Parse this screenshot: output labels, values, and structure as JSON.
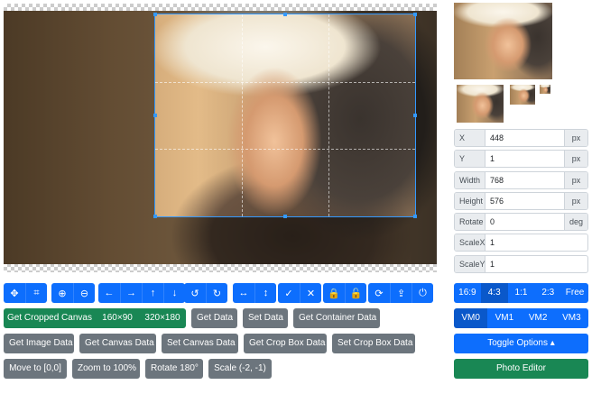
{
  "stage": {
    "grid_lines": true
  },
  "toolbar_icons": [
    {
      "group": "mode",
      "icons": [
        {
          "name": "move-icon",
          "glyph": "✥"
        },
        {
          "name": "crop-icon",
          "glyph": "⌗"
        }
      ]
    },
    {
      "group": "zoom",
      "icons": [
        {
          "name": "zoom-in-icon",
          "glyph": "⊕"
        },
        {
          "name": "zoom-out-icon",
          "glyph": "⊖"
        }
      ]
    },
    {
      "group": "move",
      "icons": [
        {
          "name": "arrow-left-icon",
          "glyph": "←"
        },
        {
          "name": "arrow-right-icon",
          "glyph": "→"
        },
        {
          "name": "arrow-up-icon",
          "glyph": "↑"
        },
        {
          "name": "arrow-down-icon",
          "glyph": "↓"
        }
      ]
    },
    {
      "group": "rotate",
      "icons": [
        {
          "name": "rotate-left-icon",
          "glyph": "↺"
        },
        {
          "name": "rotate-right-icon",
          "glyph": "↻"
        }
      ]
    },
    {
      "group": "flip",
      "icons": [
        {
          "name": "flip-horizontal-icon",
          "glyph": "↔"
        },
        {
          "name": "flip-vertical-icon",
          "glyph": "↕"
        }
      ]
    },
    {
      "group": "crop-action",
      "icons": [
        {
          "name": "check-icon",
          "glyph": "✓"
        },
        {
          "name": "close-icon",
          "glyph": "✕"
        }
      ]
    },
    {
      "group": "lock",
      "icons": [
        {
          "name": "lock-icon",
          "glyph": "🔒"
        },
        {
          "name": "unlock-icon",
          "glyph": "🔓"
        }
      ]
    },
    {
      "group": "misc",
      "icons": [
        {
          "name": "reset-icon",
          "glyph": "⟳"
        },
        {
          "name": "upload-icon",
          "glyph": "⇪"
        },
        {
          "name": "power-icon",
          "glyph": "⏻"
        }
      ]
    }
  ],
  "buttons": {
    "get_cropped_canvas": "Get Cropped Canvas",
    "size_160": "160×90",
    "size_320": "320×180",
    "get_data": "Get Data",
    "set_data": "Set Data",
    "get_container_data": "Get Container Data",
    "get_image_data": "Get Image Data",
    "get_canvas_data": "Get Canvas Data",
    "set_canvas_data": "Set Canvas Data",
    "get_crop_box_data": "Get Crop Box Data",
    "set_crop_box_data": "Set Crop Box Data",
    "move_to": "Move to [0,0]",
    "zoom_to": "Zoom to 100%",
    "rotate_180": "Rotate 180°",
    "scale": "Scale (-2, -1)"
  },
  "data_fields": [
    {
      "label": "X",
      "value": "448",
      "unit": "px"
    },
    {
      "label": "Y",
      "value": "1",
      "unit": "px"
    },
    {
      "label": "Width",
      "value": "768",
      "unit": "px"
    },
    {
      "label": "Height",
      "value": "576",
      "unit": "px"
    },
    {
      "label": "Rotate",
      "value": "0",
      "unit": "deg"
    },
    {
      "label": "ScaleX",
      "value": "1",
      "unit": ""
    },
    {
      "label": "ScaleY",
      "value": "1",
      "unit": ""
    }
  ],
  "aspect_ratios": {
    "options": [
      "16:9",
      "4:3",
      "1:1",
      "2:3",
      "Free"
    ],
    "selected": "4:3"
  },
  "view_modes": {
    "options": [
      "VM0",
      "VM1",
      "VM2",
      "VM3"
    ],
    "selected": "VM0"
  },
  "toggle_options": "Toggle Options ▴",
  "photo_editor": "Photo Editor",
  "colors": {
    "primary": "#0d6efd",
    "success": "#198754",
    "secondary": "#6c757d",
    "crop_outline": "#3399ff"
  }
}
